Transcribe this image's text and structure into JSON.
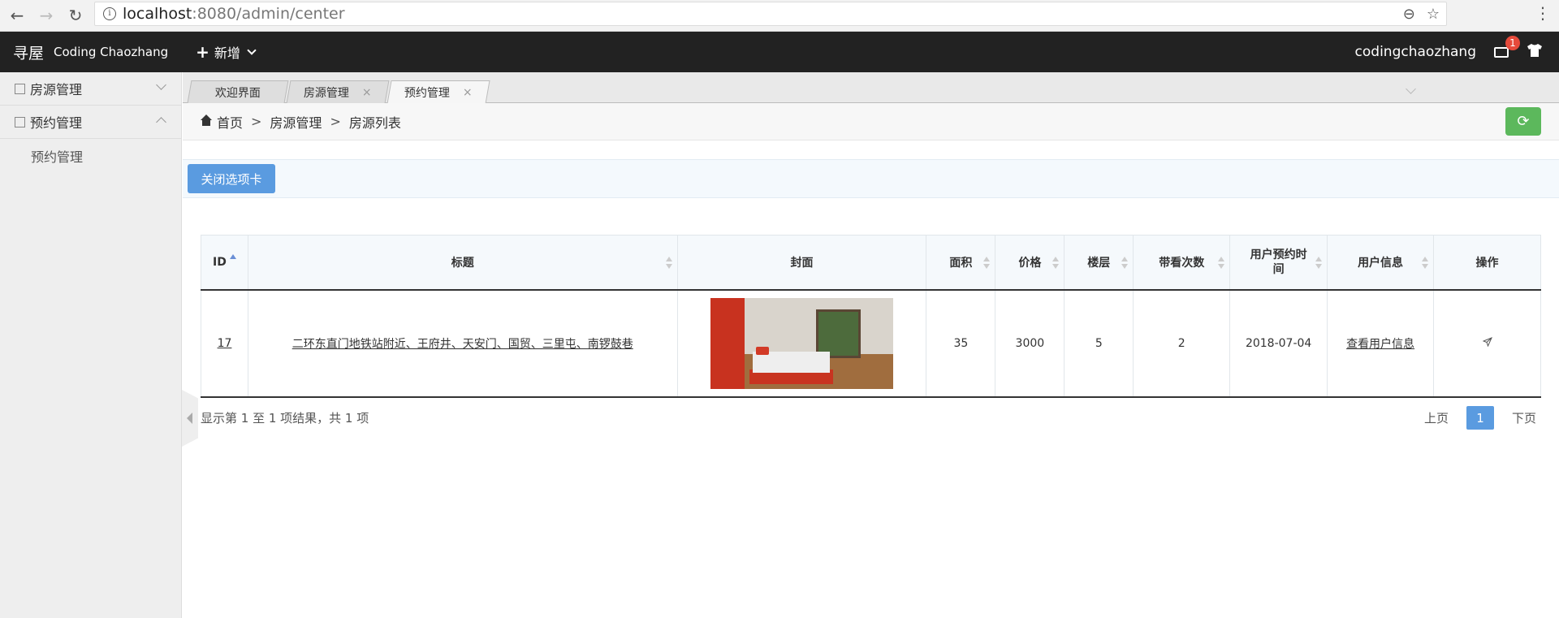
{
  "browser": {
    "url_host": "localhost",
    "url_path": ":8080/admin/center"
  },
  "header": {
    "logo_cn": "寻屋",
    "logo_en": "Coding Chaozhang",
    "add_label": "新增",
    "username": "codingchaozhang",
    "mail_count": "1"
  },
  "sidebar": {
    "items": [
      {
        "label": "房源管理"
      },
      {
        "label": "预约管理"
      }
    ],
    "sub_items": [
      {
        "label": "预约管理"
      }
    ]
  },
  "tabs": [
    {
      "label": "欢迎界面"
    },
    {
      "label": "房源管理"
    },
    {
      "label": "预约管理"
    }
  ],
  "breadcrumb": [
    "首页",
    "房源管理",
    "房源列表"
  ],
  "toolbar": {
    "close_tab_label": "关闭选项卡"
  },
  "table": {
    "headers": [
      "ID",
      "标题",
      "封面",
      "面积",
      "价格",
      "楼层",
      "带看次数",
      "用户预约时间",
      "用户信息",
      "操作"
    ],
    "rows": [
      {
        "id": "17",
        "title": "二环东直门地铁站附近、王府井、天安门、国贸、三里屯、南锣鼓巷",
        "area": "35",
        "price": "3000",
        "floor": "5",
        "views": "2",
        "appointment_time": "2018-07-04",
        "user_info_link": "查看用户信息"
      }
    ]
  },
  "footer": {
    "summary": "显示第 1 至 1 项结果，共 1 项",
    "prev": "上页",
    "page": "1",
    "next": "下页"
  },
  "colors": {
    "header_bg": "#222222",
    "primary_blue": "#5a9be0",
    "refresh_green": "#5cb85c",
    "badge_red": "#e64a3b"
  }
}
